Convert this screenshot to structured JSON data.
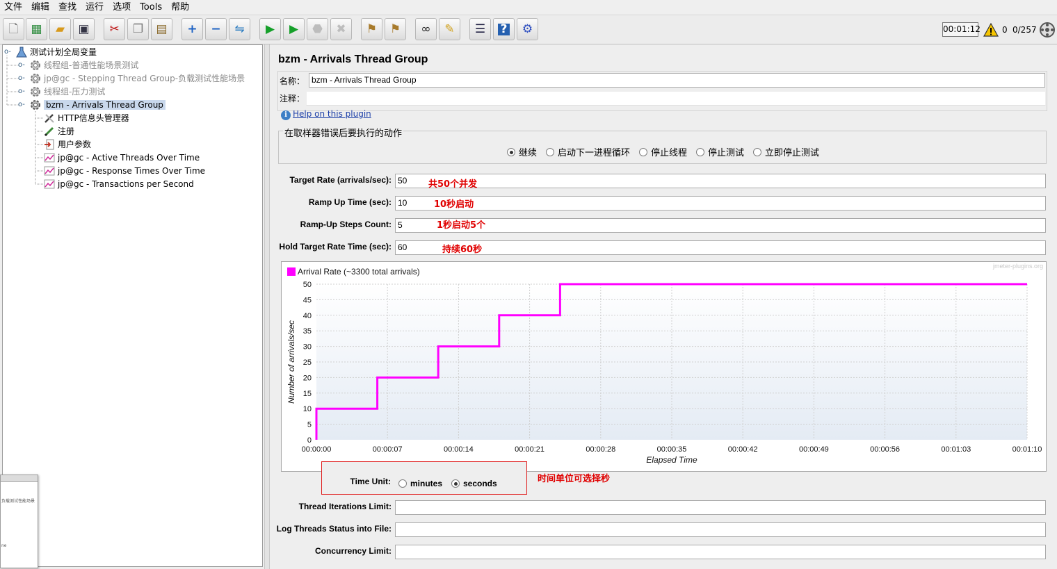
{
  "menu": [
    "文件",
    "编辑",
    "查找",
    "运行",
    "选项",
    "Tools",
    "帮助"
  ],
  "toolbar": {
    "buttons": [
      {
        "name": "new-button",
        "icon": "new-file-icon",
        "glyph": "🗋"
      },
      {
        "name": "templates-button",
        "icon": "templates-icon",
        "glyph": "▦"
      },
      {
        "name": "open-button",
        "icon": "open-folder-icon",
        "glyph": "📂"
      },
      {
        "name": "save-button",
        "icon": "save-icon",
        "glyph": "💾"
      },
      {
        "name": "cut-button",
        "icon": "scissors-icon",
        "glyph": "✂"
      },
      {
        "name": "copy-button",
        "icon": "copy-icon",
        "glyph": "❐"
      },
      {
        "name": "paste-button",
        "icon": "paste-icon",
        "glyph": "📋"
      },
      {
        "name": "expand-button",
        "icon": "plus-icon",
        "glyph": "+"
      },
      {
        "name": "collapse-button",
        "icon": "minus-icon",
        "glyph": "−"
      },
      {
        "name": "toggle-button",
        "icon": "toggle-icon",
        "glyph": "⇋"
      },
      {
        "name": "start-button",
        "icon": "play-icon",
        "glyph": "▶"
      },
      {
        "name": "start-no-pauses-button",
        "icon": "play-no-pause-icon",
        "glyph": "▶"
      },
      {
        "name": "stop-button",
        "icon": "stop-icon",
        "glyph": "⬣",
        "disabled": true
      },
      {
        "name": "shutdown-button",
        "icon": "shutdown-icon",
        "glyph": "✖",
        "disabled": true
      },
      {
        "name": "clear-button",
        "icon": "broom-icon",
        "glyph": "🧹"
      },
      {
        "name": "clear-all-button",
        "icon": "broom-all-icon",
        "glyph": "🧹"
      },
      {
        "name": "search-button",
        "icon": "binoculars-icon",
        "glyph": "🔭"
      },
      {
        "name": "reset-search-button",
        "icon": "eraser-icon",
        "glyph": "✎"
      },
      {
        "name": "function-helper-button",
        "icon": "list-icon",
        "glyph": "☰"
      },
      {
        "name": "help-button",
        "icon": "help-icon",
        "glyph": "?"
      },
      {
        "name": "remote-button",
        "icon": "remote-icon",
        "glyph": "⚙"
      }
    ],
    "timer": "00:01:12",
    "error_count": "0",
    "threads": "0/257"
  },
  "tree": {
    "root": "测试计划全局变量",
    "items": [
      {
        "label": "线程组-普通性能场景测试",
        "disabled": true
      },
      {
        "label": "jp@gc - Stepping Thread Group-负载测试性能场景",
        "disabled": true
      },
      {
        "label": "线程组-压力测试",
        "disabled": true
      },
      {
        "label": "bzm - Arrivals Thread Group",
        "selected": true
      }
    ],
    "children": [
      {
        "label": "HTTP信息头管理器",
        "icon": "wrench-icon"
      },
      {
        "label": "注册",
        "icon": "pen-icon"
      },
      {
        "label": "用户参数",
        "icon": "arrow-doc-icon"
      },
      {
        "label": "jp@gc - Active Threads Over Time",
        "icon": "graph-icon"
      },
      {
        "label": "jp@gc - Response Times Over Time",
        "icon": "graph-icon"
      },
      {
        "label": "jp@gc - Transactions per Second",
        "icon": "graph-icon"
      }
    ]
  },
  "mini_window": {
    "line1": "负载测试性能场景",
    "line2": "ne"
  },
  "panel": {
    "title": "bzm - Arrivals Thread Group",
    "name_label": "名称：",
    "name_value": "bzm - Arrivals Thread Group",
    "comment_label": "注释：",
    "comment_value": "",
    "help_link": "Help on this plugin"
  },
  "error_action": {
    "title": "在取样器错误后要执行的动作",
    "options": [
      "继续",
      "启动下一进程循环",
      "停止线程",
      "停止测试",
      "立即停止测试"
    ],
    "selected": 0
  },
  "params": [
    {
      "label": "Target Rate (arrivals/sec):",
      "value": "50",
      "note": "共50个并发"
    },
    {
      "label": "Ramp Up Time (sec):",
      "value": "10",
      "note": "10秒启动"
    },
    {
      "label": "Ramp-Up Steps Count:",
      "value": "5",
      "note": "1秒启动5个"
    },
    {
      "label": "Hold Target Rate Time (sec):",
      "value": "60",
      "note": "持续60秒"
    }
  ],
  "chart_data": {
    "type": "line",
    "watermark": "jmeter-plugins.org",
    "series": [
      {
        "name": "Arrival Rate (~3300 total arrivals)",
        "color": "#ff00ff",
        "points": [
          [
            0,
            0
          ],
          [
            0,
            10
          ],
          [
            6,
            10
          ],
          [
            6,
            20
          ],
          [
            12,
            20
          ],
          [
            12,
            30
          ],
          [
            18,
            30
          ],
          [
            18,
            40
          ],
          [
            24,
            40
          ],
          [
            24,
            50
          ],
          [
            70,
            50
          ]
        ]
      }
    ],
    "ylabel": "Number of arrivals/sec",
    "xlabel": "Elapsed Time",
    "ylim": [
      0,
      50
    ],
    "yticks": [
      "0",
      "5",
      "10",
      "15",
      "20",
      "25",
      "30",
      "35",
      "40",
      "45",
      "50"
    ],
    "xlim": [
      0,
      70
    ],
    "xtick_values": [
      0,
      7,
      14,
      21,
      28,
      35,
      42,
      49,
      56,
      63,
      70
    ],
    "xticks": [
      "00:00:00",
      "00:00:07",
      "00:00:14",
      "00:00:21",
      "00:00:28",
      "00:00:35",
      "00:00:42",
      "00:00:49",
      "00:00:56",
      "00:01:03",
      "00:01:10"
    ],
    "grid": true
  },
  "time_unit": {
    "label": "Time Unit:",
    "options": [
      "minutes",
      "seconds"
    ],
    "selected": 1,
    "note": "时间单位可选择秒"
  },
  "limits": [
    {
      "label": "Thread Iterations Limit:",
      "value": ""
    },
    {
      "label": "Log Threads Status into File:",
      "value": ""
    },
    {
      "label": "Concurrency Limit:",
      "value": ""
    }
  ]
}
